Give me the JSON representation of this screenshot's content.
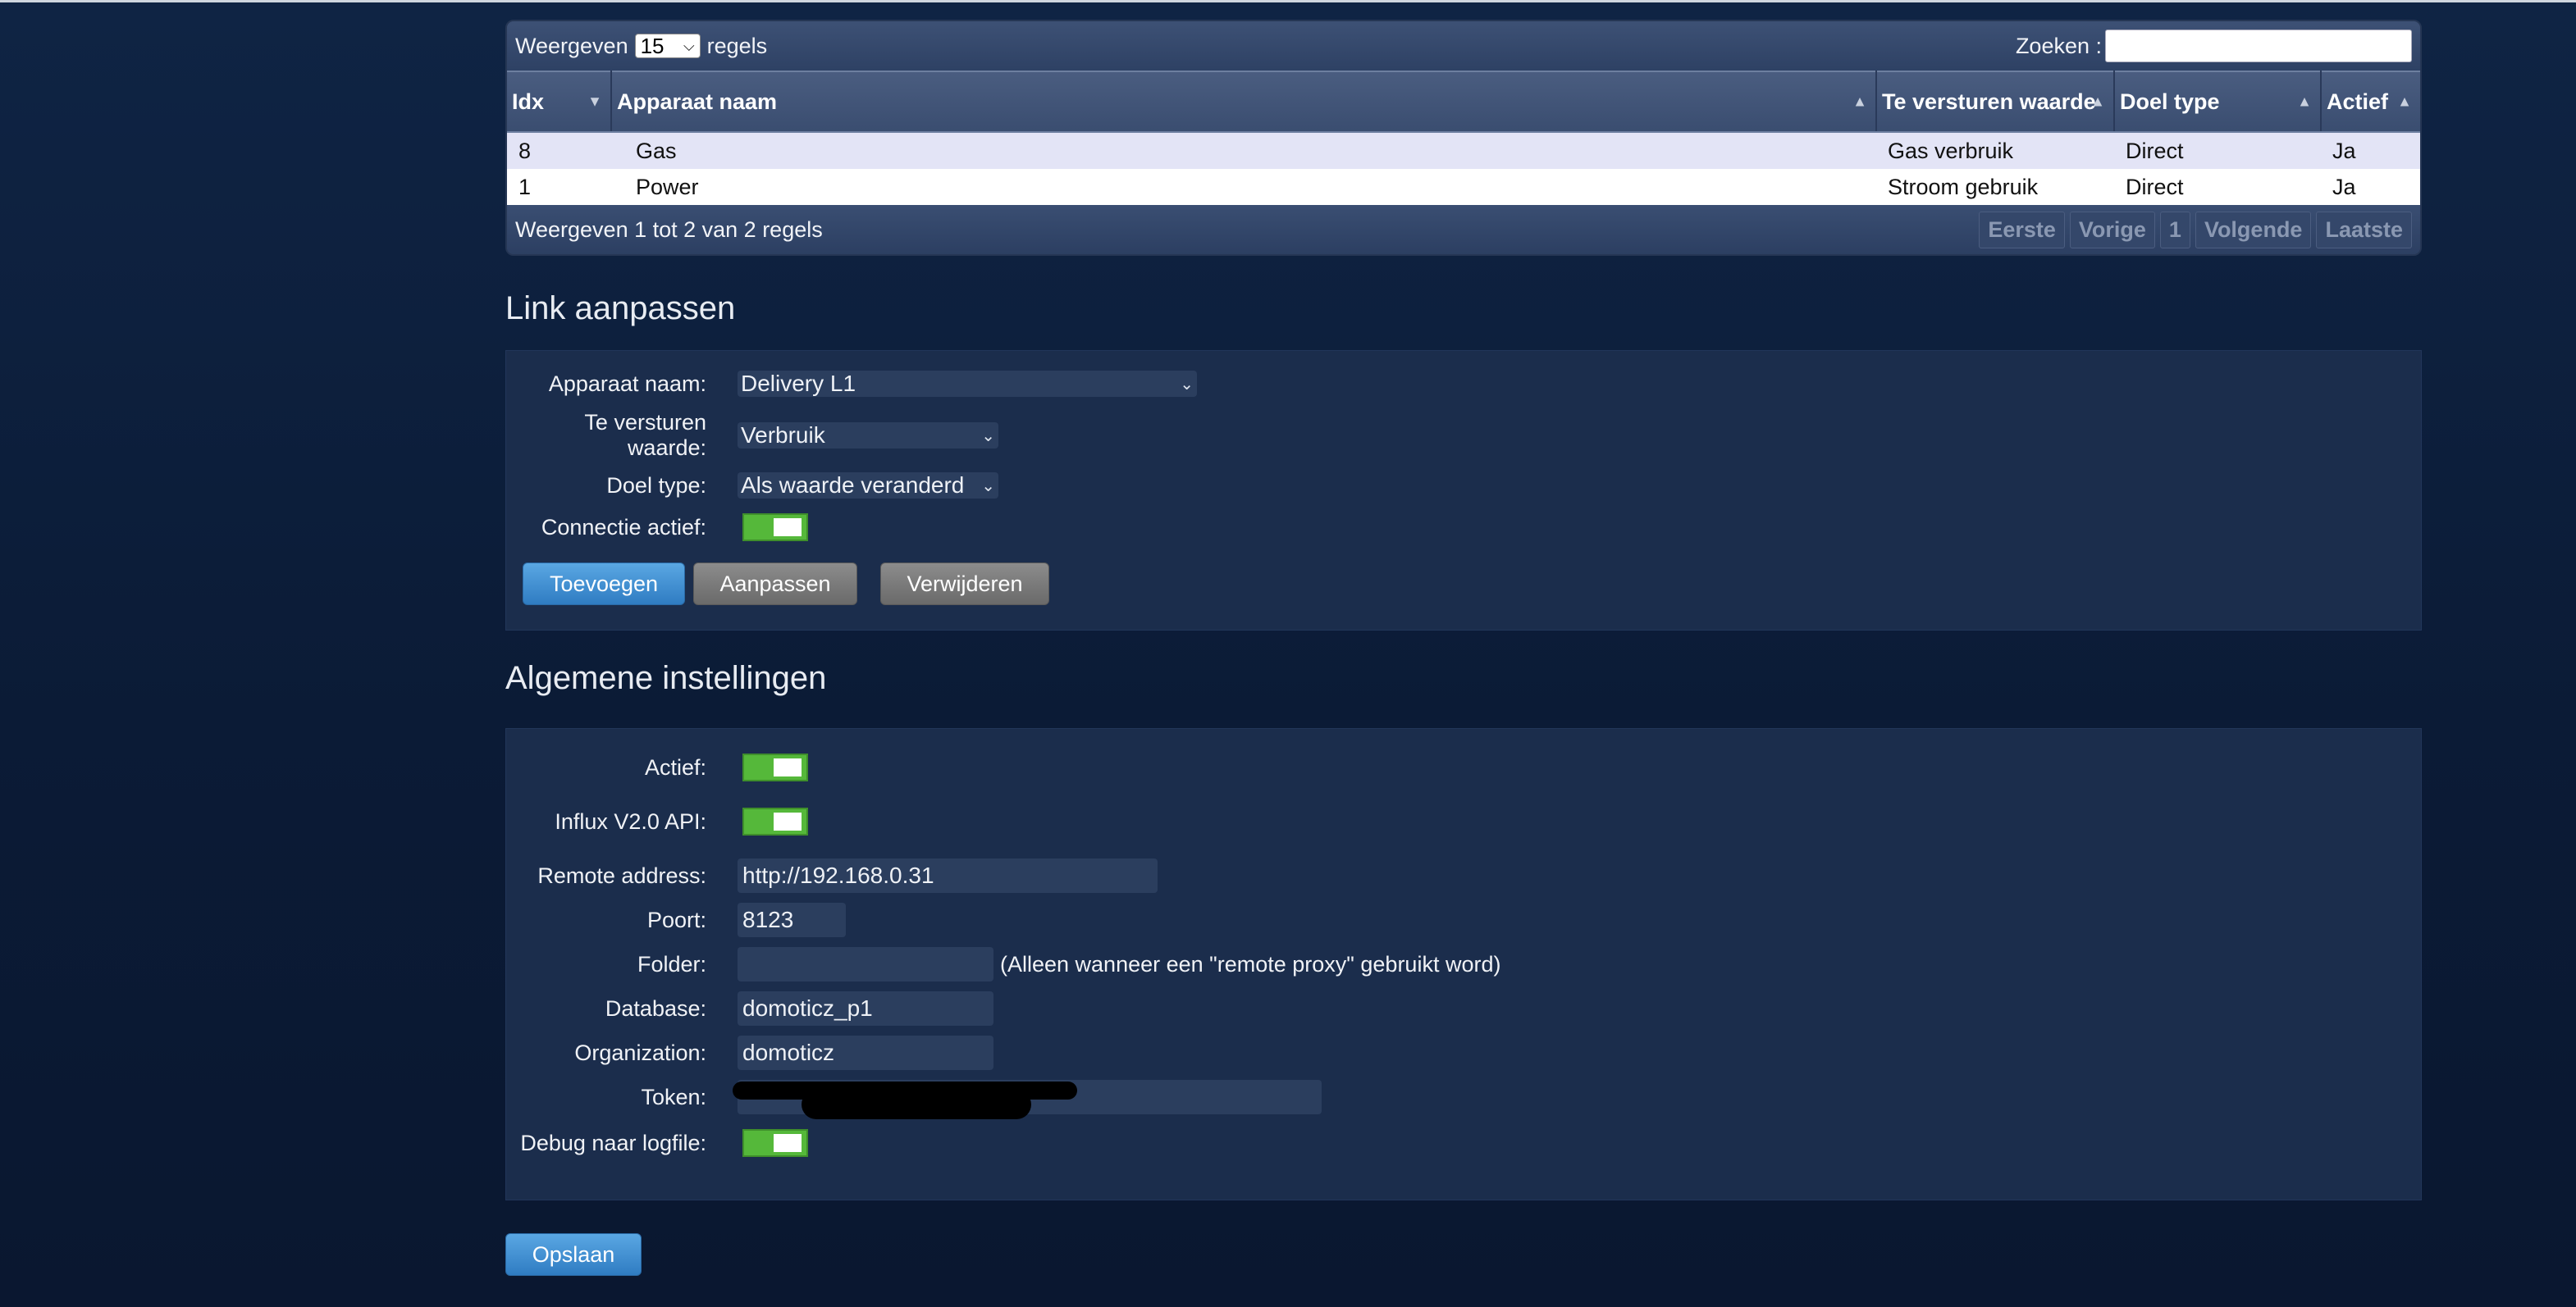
{
  "table": {
    "length_label_before": "Weergeven",
    "length_value": "15",
    "length_label_after": "regels",
    "search_label": "Zoeken :",
    "columns": [
      "Idx",
      "Apparaat naam",
      "Te versturen waarde",
      "Doel type",
      "Actief"
    ],
    "rows": [
      {
        "idx": "8",
        "name": "Gas",
        "value": "Gas verbruik",
        "type": "Direct",
        "active": "Ja"
      },
      {
        "idx": "1",
        "name": "Power",
        "value": "Stroom gebruik",
        "type": "Direct",
        "active": "Ja"
      }
    ],
    "info": "Weergeven 1 tot 2 van 2 regels",
    "pager": {
      "first": "Eerste",
      "prev": "Vorige",
      "page": "1",
      "next": "Volgende",
      "last": "Laatste"
    }
  },
  "link": {
    "title": "Link aanpassen",
    "device_label": "Apparaat naam:",
    "device_value": "Delivery L1",
    "send_label": "Te versturen waarde:",
    "send_value": "Verbruik",
    "type_label": "Doel type:",
    "type_value": "Als waarde veranderd",
    "active_label": "Connectie actief:",
    "active_on": true,
    "add_button": "Toevoegen",
    "update_button": "Aanpassen",
    "delete_button": "Verwijderen"
  },
  "settings": {
    "title": "Algemene instellingen",
    "active_label": "Actief:",
    "influx_label": "Influx V2.0 API:",
    "remote_label": "Remote address:",
    "remote_value": "http://192.168.0.31",
    "port_label": "Poort:",
    "port_value": "8123",
    "folder_label": "Folder:",
    "folder_value": "",
    "folder_note": "(Alleen wanneer een \"remote proxy\" gebruikt word)",
    "database_label": "Database:",
    "database_value": "domoticz_p1",
    "org_label": "Organization:",
    "org_value": "domoticz",
    "token_label": "Token:",
    "debug_label": "Debug naar logfile:",
    "save_button": "Opslaan"
  },
  "colors": {
    "toggle_on": "#55b83a",
    "button_blue": "#2f7cc2",
    "button_gray": "#6a6a6a"
  }
}
